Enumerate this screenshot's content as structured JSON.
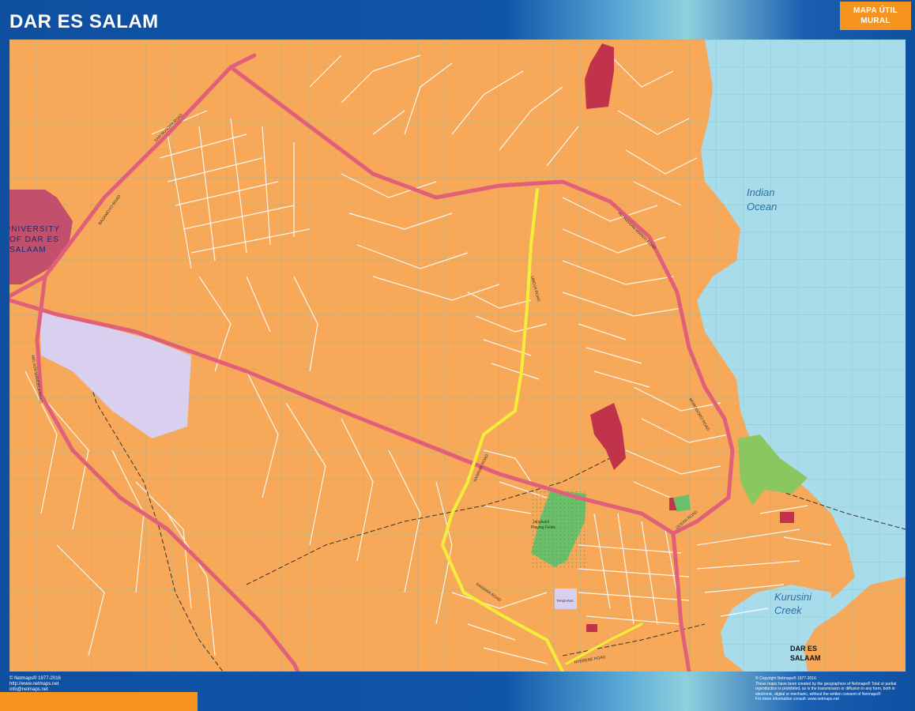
{
  "header": {
    "title": "DAR ES SALAM",
    "badge_line1": "MAPA ÚTIL",
    "badge_line2": "MURAL"
  },
  "colors": {
    "land": "#f7a959",
    "water": "#a8dcea",
    "main_road": "#e0607a",
    "highlight_road": "#f2ee3a",
    "university": "#c2506c",
    "landmark_red": "#c0334a",
    "park_green": "#6cbf6a",
    "lavender": "#d9d0f0",
    "grid": "#5bb5b0",
    "frame_blue": "#0f4fa0",
    "accent_orange": "#f7941d"
  },
  "map": {
    "area_labels": {
      "ocean_line1": "Indian",
      "ocean_line2": "Ocean",
      "creek_line1": "Kurusini",
      "creek_line2": "Creek",
      "city_line1": "DAR ES",
      "city_line2": "SALAAM",
      "university_line1": "UNIVERSITY",
      "university_line2": "OF DAR ES",
      "university_line3": "SALAAM",
      "golf_line1": "Jangwani",
      "golf_line2": "Playing Fields",
      "hospital": "TANZANIA"
    },
    "road_labels": {
      "sam_nujoma": "SAM NUJOMA ROAD",
      "bagamoyo": "BAGAMOYO ROAD",
      "ali_hassan": "ALI HASSAN MWINYI ROAD",
      "morogoro": "MOROGORO ROAD",
      "nelson_mandela": "NELSON MANDELA ROAD",
      "kawawa": "KAWAWA ROAD",
      "ocean_road": "OCEAN ROAD",
      "nyerere": "NYERERE ROAD",
      "umoja": "UMOJA ROAD"
    }
  },
  "footer": {
    "left_line1": "© Netmaps® 1977-2016",
    "left_line2": "http://www.netmaps.net",
    "left_line3": "info@netmaps.net",
    "right_line1": "© Copyright Netmaps® 1977-2016",
    "right_line2": "These maps have been created by the geographers of Netmaps® Total or partial",
    "right_line3": "reproduction is prohibited, as is the transmission or diffusion in any form, both in",
    "right_line4": "electronic, digital or mechanic, without the written consent of Netmaps®",
    "right_line5": "For more information consult: www.netmaps.net"
  }
}
